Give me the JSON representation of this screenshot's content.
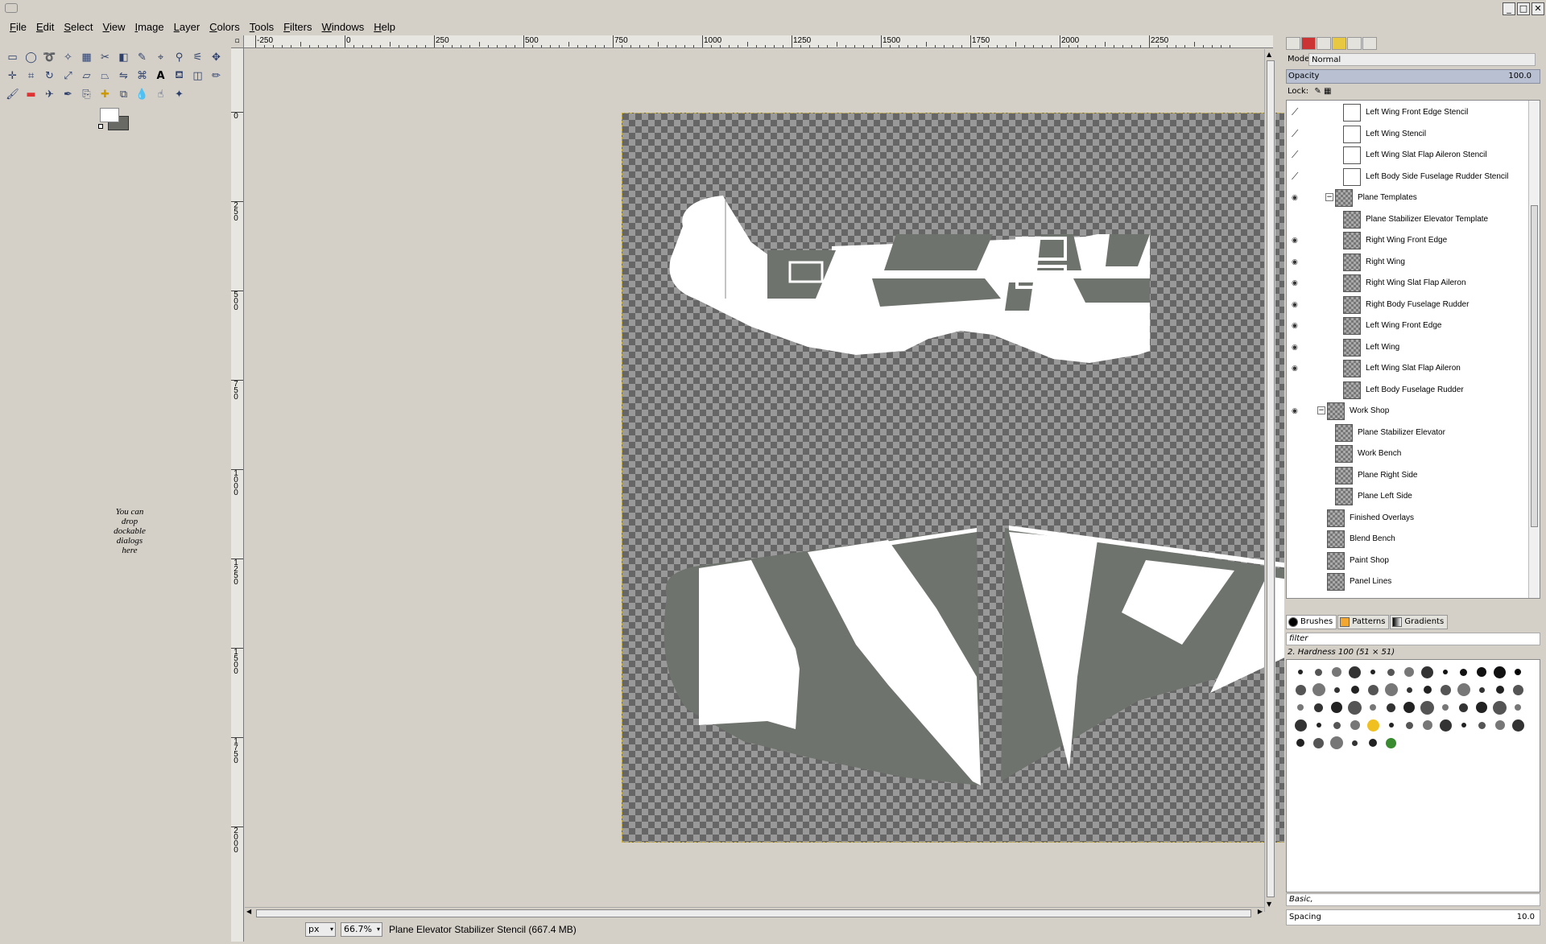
{
  "window": {
    "controls": [
      "_",
      "□",
      "✕"
    ]
  },
  "menubar": {
    "items": [
      "File",
      "Edit",
      "Select",
      "View",
      "Image",
      "Layer",
      "Colors",
      "Tools",
      "Filters",
      "Windows",
      "Help"
    ]
  },
  "toolbox": {
    "drop_hint": "You can drop dockable dialogs here"
  },
  "rulers": {
    "horizontal_labels": [
      "-250",
      "0",
      "250",
      "500",
      "750",
      "1000",
      "1250",
      "1500",
      "1750",
      "2000",
      "2250"
    ],
    "vertical_labels": [
      "0",
      "250",
      "500",
      "750",
      "1000",
      "1250",
      "1500",
      "1750",
      "2000"
    ]
  },
  "statusbar": {
    "unit": "px",
    "zoom": "66.7%",
    "message": "Plane Elevator Stabilizer Stencil (667.4 MB)"
  },
  "layers_panel": {
    "mode_label": "Mode:",
    "mode_value": "Normal",
    "opacity_label": "Opacity",
    "opacity_value": "100.0",
    "lock_label": "Lock:",
    "layers": [
      {
        "name": "Left Wing Front Edge Stencil",
        "indent": 2,
        "thumb": "white",
        "marker": "chain"
      },
      {
        "name": "Left Wing Stencil",
        "indent": 2,
        "thumb": "white",
        "marker": "chain"
      },
      {
        "name": "Left Wing Slat Flap Aileron Stencil",
        "indent": 2,
        "thumb": "white",
        "marker": "chain"
      },
      {
        "name": "Left Body Side Fuselage Rudder Stencil",
        "indent": 2,
        "thumb": "white",
        "marker": "chain"
      },
      {
        "name": "Plane Templates",
        "indent": 1,
        "thumb": "checker",
        "marker": "eye",
        "expander": "⊟"
      },
      {
        "name": "Plane Stabilizer Elevator Template",
        "indent": 2,
        "thumb": "checker",
        "marker": ""
      },
      {
        "name": "Right Wing Front Edge",
        "indent": 2,
        "thumb": "checker",
        "marker": "eye"
      },
      {
        "name": "Right Wing",
        "indent": 2,
        "thumb": "checker",
        "marker": "eye"
      },
      {
        "name": "Right Wing Slat Flap Aileron",
        "indent": 2,
        "thumb": "checker",
        "marker": "eye"
      },
      {
        "name": "Right Body Fuselage Rudder",
        "indent": 2,
        "thumb": "checker",
        "marker": "eye"
      },
      {
        "name": "Left Wing Front Edge",
        "indent": 2,
        "thumb": "checker",
        "marker": "eye"
      },
      {
        "name": "Left Wing",
        "indent": 2,
        "thumb": "checker",
        "marker": "eye"
      },
      {
        "name": "Left Wing Slat Flap Aileron",
        "indent": 2,
        "thumb": "checker",
        "marker": "eye"
      },
      {
        "name": "Left Body Fuselage Rudder",
        "indent": 2,
        "thumb": "checker",
        "marker": ""
      },
      {
        "name": "Work Shop",
        "indent": 0,
        "thumb": "checker",
        "marker": "eye",
        "expander": "⊟"
      },
      {
        "name": "Plane Stabilizer Elevator",
        "indent": 1,
        "thumb": "checker",
        "marker": ""
      },
      {
        "name": "Work Bench",
        "indent": 1,
        "thumb": "checker",
        "marker": ""
      },
      {
        "name": "Plane Right Side",
        "indent": 1,
        "thumb": "checker",
        "marker": ""
      },
      {
        "name": "Plane Left Side",
        "indent": 1,
        "thumb": "checker",
        "marker": ""
      },
      {
        "name": "Finished Overlays",
        "indent": 0,
        "thumb": "checker",
        "marker": ""
      },
      {
        "name": "Blend Bench",
        "indent": 0,
        "thumb": "checker",
        "marker": ""
      },
      {
        "name": "Paint Shop",
        "indent": 0,
        "thumb": "checker",
        "marker": ""
      },
      {
        "name": "Panel Lines",
        "indent": 0,
        "thumb": "checker",
        "marker": ""
      }
    ]
  },
  "brushes_panel": {
    "tabs": [
      "Brushes",
      "Patterns",
      "Gradients"
    ],
    "filter_placeholder": "filter",
    "selected_brush": "2. Hardness 100 (51 × 51)",
    "preset": "Basic,",
    "spacing_label": "Spacing",
    "spacing_value": "10.0"
  },
  "colors": {
    "canvas_bg": "#d4d0c8",
    "checker_dark": "#666666",
    "checker_light": "#999999",
    "stencil_white": "#ffffff",
    "stripe_gray": "#6f736d"
  }
}
